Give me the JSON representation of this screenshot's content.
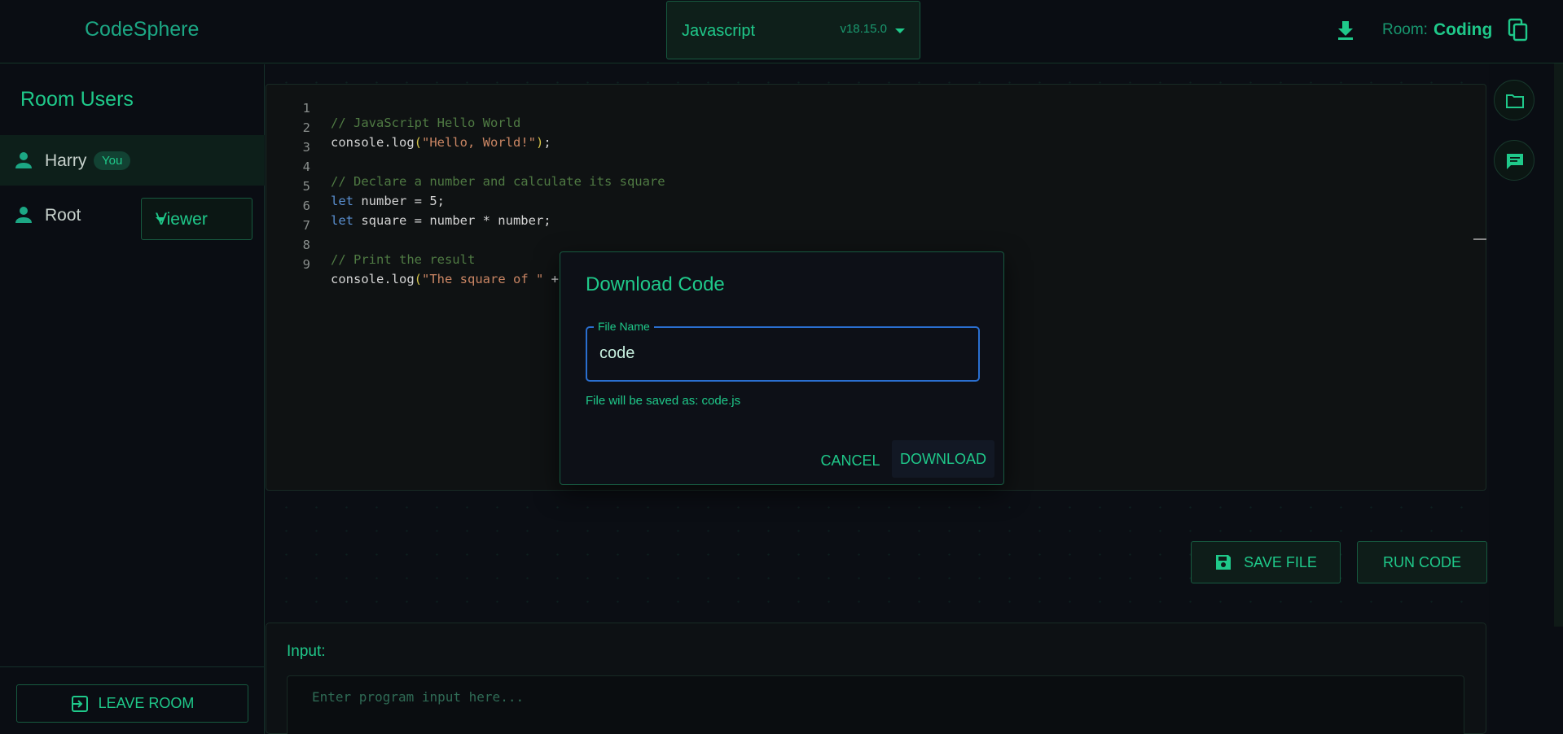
{
  "app": {
    "brand": "CodeSphere"
  },
  "language_select": {
    "name": "Javascript",
    "version": "v18.15.0"
  },
  "room": {
    "label": "Room:",
    "name": "Coding"
  },
  "sidebar": {
    "title": "Room Users",
    "users": [
      {
        "name": "Harry",
        "badge": "You"
      },
      {
        "name": "Root",
        "role": "Viewer"
      }
    ],
    "leave_label": "LEAVE ROOM"
  },
  "editor": {
    "line_numbers": [
      "1",
      "2",
      "3",
      "4",
      "5",
      "6",
      "7",
      "8",
      "9"
    ],
    "lines": [
      "// JavaScript Hello World",
      "console.log(\"Hello, World!\");",
      "",
      "// Declare a number and calculate its square",
      "let number = 5;",
      "let square = number * number;",
      "",
      "// Print the result",
      "console.log(\"The square of \" + number + \" is \" + square);"
    ]
  },
  "actions": {
    "save_label": "SAVE FILE",
    "run_label": "RUN CODE"
  },
  "input_panel": {
    "label": "Input:",
    "placeholder": "Enter program input here..."
  },
  "dialog": {
    "title": "Download Code",
    "field_label": "File Name",
    "field_value": "code",
    "helper": "File will be saved as: code.js",
    "cancel_label": "CANCEL",
    "download_label": "DOWNLOAD"
  },
  "icons": {
    "download": "download-icon",
    "copy": "copy-icon",
    "user": "person-icon",
    "exit": "exit-icon",
    "folder": "folder-icon",
    "chat": "chat-icon",
    "save": "floppy-disk-icon"
  },
  "colors": {
    "accent": "#1fc98a",
    "focus": "#2a6fd0",
    "background": "#0b0e14"
  }
}
